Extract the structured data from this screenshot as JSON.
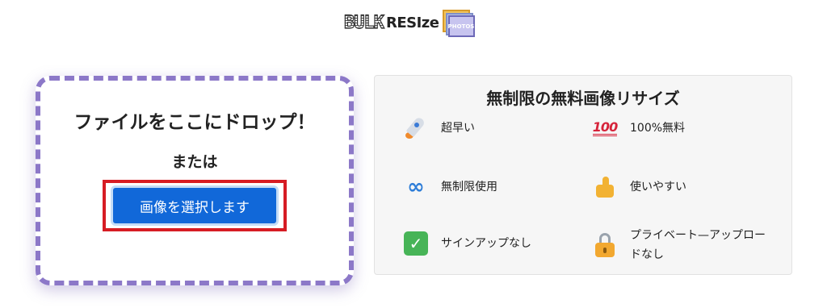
{
  "logo": {
    "bulk": "BULK",
    "resize": "RESIze",
    "photos": "PHOTOS"
  },
  "drop_zone": {
    "title": "ファイルをここにドロップ！",
    "or": "または",
    "select_button": "画像を選択します"
  },
  "features": {
    "title": "無制限の無料画像リサイズ",
    "items": [
      {
        "icon": "rocket-icon",
        "label": "超早い"
      },
      {
        "icon": "hundred-points-icon",
        "label": "100%無料"
      },
      {
        "icon": "infinity-icon",
        "label": "無制限使用"
      },
      {
        "icon": "thumbs-up-icon",
        "label": "使いやすい"
      },
      {
        "icon": "check-mark-icon",
        "label": "サインアップなし"
      },
      {
        "icon": "lock-icon",
        "label": "プライベート—アップロードなし"
      }
    ]
  },
  "colors": {
    "accent": "#1168d9",
    "drop_border": "#8c78c8",
    "highlight": "#d61c24"
  }
}
